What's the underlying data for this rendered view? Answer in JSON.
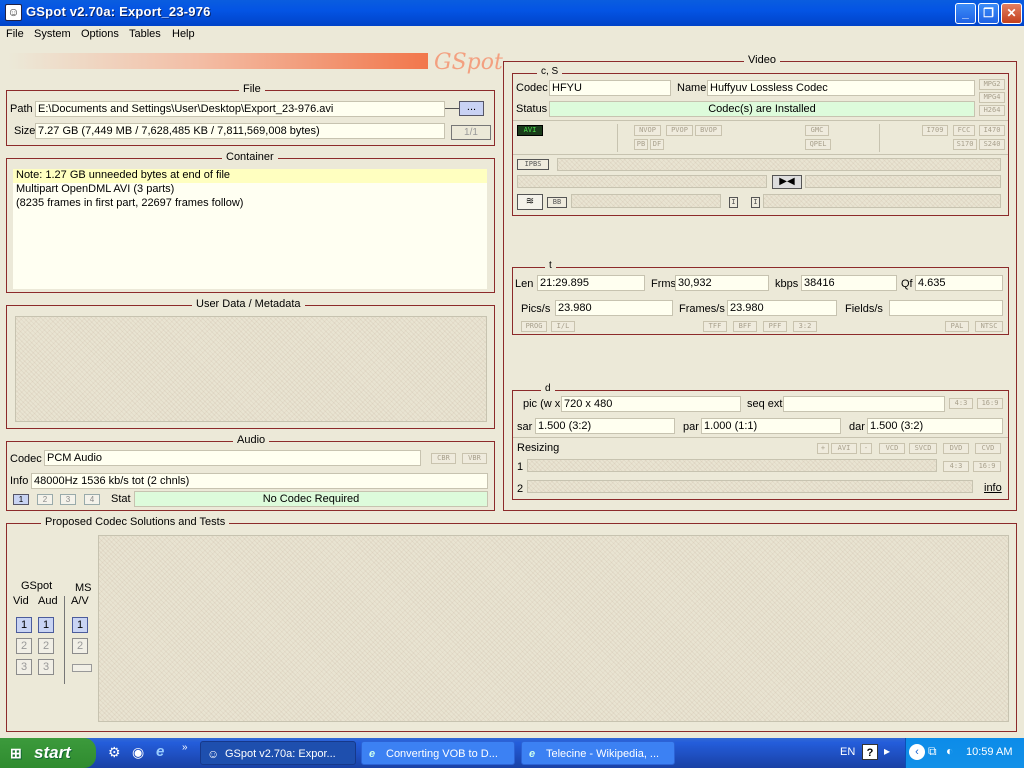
{
  "window": {
    "title": "GSpot v2.70a: Export_23-976",
    "logo": "GSpot"
  },
  "menu": [
    "File",
    "System",
    "Options",
    "Tables",
    "Help"
  ],
  "file": {
    "title": "File",
    "path_label": "Path",
    "path_value": "E:\\Documents and Settings\\User\\Desktop\\Export_23-976.avi",
    "browse_label": "...",
    "size_label": "Size",
    "size_value": "7.27 GB (7,449 MB / 7,628,485 KB / 7,811,569,008 bytes)",
    "part_value": "1/1"
  },
  "container": {
    "title": "Container",
    "lines": [
      "Note: 1.27 GB unneeded bytes at end of file",
      "Multipart OpenDML AVI (3 parts)",
      "(8235 frames in first part, 22697 frames follow)"
    ]
  },
  "userdata": {
    "title": "User Data / Metadata"
  },
  "audio": {
    "title": "Audio",
    "codec_label": "Codec",
    "codec_value": "PCM Audio",
    "cbr": "CBR",
    "vbr": "VBR",
    "info_label": "Info",
    "info_value": "48000Hz  1536 kb/s tot (2 chnls)",
    "streams": [
      "1",
      "2",
      "3",
      "4"
    ],
    "stat_label": "Stat",
    "stat_value": "No Codec Required"
  },
  "video": {
    "title": "Video",
    "cs_title": "c, S",
    "codec_label": "Codec",
    "codec_value": "HFYU",
    "name_label": "Name",
    "name_value": "Huffyuv Lossless Codec",
    "status_label": "Status",
    "status_value": "Codec(s) are Installed",
    "side_tags": [
      "MPG2",
      "MPG4",
      "H264"
    ],
    "avi_tag": "AVI",
    "tags_row1": [
      "NVOP",
      "PVOP",
      "BVOP",
      "GMC",
      "I709",
      "FCC",
      "I470"
    ],
    "tags_row2": [
      "PB",
      "DF",
      "QPEL",
      "S170",
      "S240"
    ],
    "ipbs": "IPBS",
    "bb": "BB",
    "i1": "I",
    "i2": "I"
  },
  "timing": {
    "title": "t",
    "len_label": "Len",
    "len_value": "21:29.895",
    "frms_label": "Frms",
    "frms_value": "30,932",
    "kbps_label": "kbps",
    "kbps_value": "38416",
    "qf_label": "Qf",
    "qf_value": "4.635",
    "pics_label": "Pics/s",
    "pics_value": "23.980",
    "frames_label": "Frames/s",
    "frames_value": "23.980",
    "fields_label": "Fields/s",
    "fields_value": "",
    "tags_left": [
      "PROG",
      "I/L"
    ],
    "tags_mid": [
      "TFF",
      "BFF",
      "PFF",
      "3:2"
    ],
    "tags_right": [
      "PAL",
      "NTSC"
    ]
  },
  "dimensions": {
    "title": "d",
    "pic_label": "pic (w x",
    "pic_value": "720 x 480",
    "seqext_label": "seq ext",
    "seqext_value": "",
    "ar_tags": [
      "4:3",
      "16:9"
    ],
    "sar_label": "sar",
    "sar_value": "1.500 (3:2)",
    "par_label": "par",
    "par_value": "1.000 (1:1)",
    "dar_label": "dar",
    "dar_value": "1.500 (3:2)",
    "resizing_label": "Resizing",
    "resize_tags": [
      "+",
      "AVI",
      "-",
      "VCD",
      "SVCD",
      "DVD",
      "CVD"
    ],
    "row1_label": "1",
    "row2_label": "2",
    "row1_tags": [
      "4:3",
      "16:9"
    ],
    "info_link": "info"
  },
  "proposed": {
    "title": "Proposed Codec Solutions and Tests",
    "gspot_label": "GSpot",
    "vid_label": "Vid",
    "aud_label": "Aud",
    "ms_label": "MS",
    "av_label": "A/V",
    "nums": [
      "1",
      "2",
      "3"
    ]
  },
  "taskbar": {
    "start": "start",
    "tasks": [
      "GSpot v2.70a: Expor...",
      "Converting VOB to D...",
      "Telecine - Wikipedia, ..."
    ],
    "lang": "EN",
    "clock": "10:59 AM"
  }
}
